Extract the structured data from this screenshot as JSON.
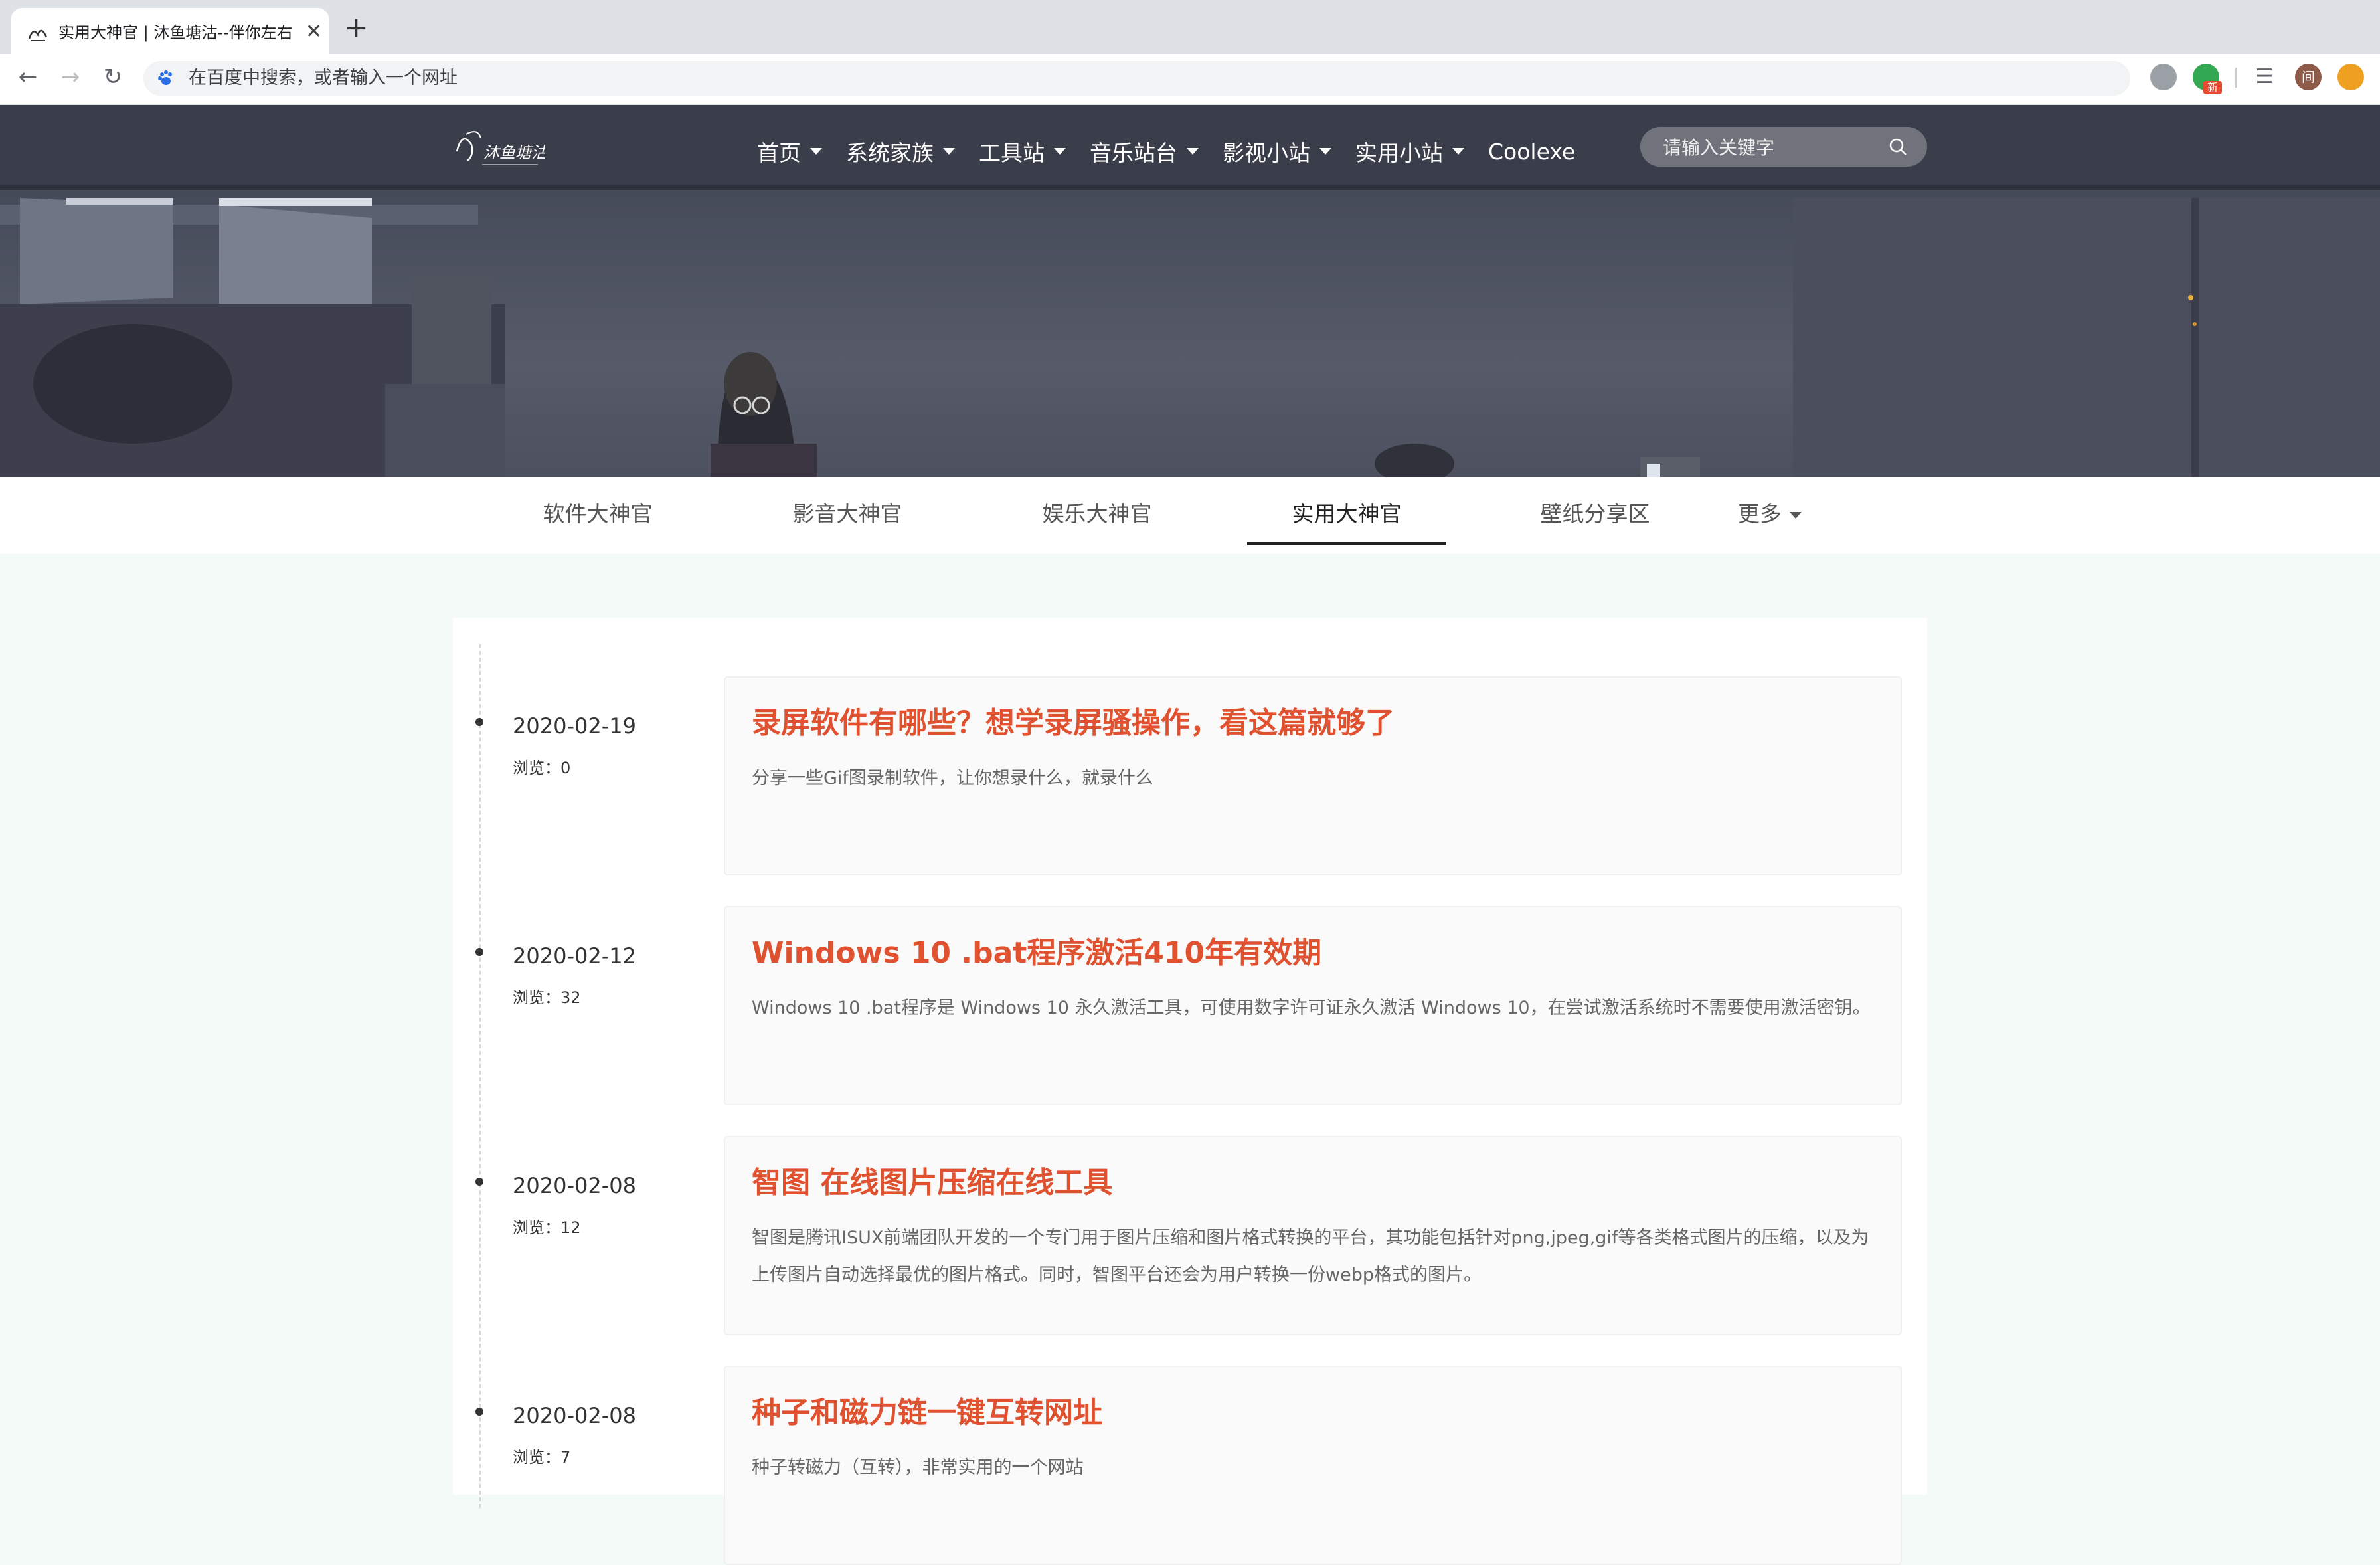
{
  "browser": {
    "tab_title": "实用大神官 | 沐鱼塘沽--伴你左右",
    "omnibox_placeholder": "在百度中搜索，或者输入一个网址",
    "ext_badge": "新",
    "profile_initial": "间"
  },
  "site": {
    "logo_text": "沐鱼塘沽",
    "nav": [
      {
        "label": "首页"
      },
      {
        "label": "系统家族"
      },
      {
        "label": "工具站"
      },
      {
        "label": "音乐站台"
      },
      {
        "label": "影视小站"
      },
      {
        "label": "实用小站"
      },
      {
        "label": "Coolexe"
      }
    ],
    "search_placeholder": "请输入关键字"
  },
  "categories": [
    {
      "label": "软件大神官"
    },
    {
      "label": "影音大神官"
    },
    {
      "label": "娱乐大神官"
    },
    {
      "label": "实用大神官",
      "active": true
    },
    {
      "label": "壁纸分享区"
    },
    {
      "label": "更多"
    }
  ],
  "posts": [
    {
      "date": "2020-02-19",
      "views": "浏览：0",
      "title": "录屏软件有哪些？想学录屏骚操作，看这篇就够了",
      "excerpt": "分享一些Gif图录制软件，让你想录什么，就录什么"
    },
    {
      "date": "2020-02-12",
      "views": "浏览：32",
      "title": "Windows 10 .bat程序激活410年有效期",
      "excerpt": "Windows 10 .bat程序是 Windows 10 永久激活工具，可使用数字许可证永久激活 Windows 10，在尝试激活系统时不需要使用激活密钥。"
    },
    {
      "date": "2020-02-08",
      "views": "浏览：12",
      "title": "智图 在线图片压缩在线工具",
      "excerpt": "智图是腾讯ISUX前端团队开发的一个专门用于图片压缩和图片格式转换的平台，其功能包括针对png,jpeg,gif等各类格式图片的压缩，以及为上传图片自动选择最优的图片格式。同时，智图平台还会为用户转换一份webp格式的图片。"
    },
    {
      "date": "2020-02-08",
      "views": "浏览：7",
      "title": "种子和磁力链一键互转网址",
      "excerpt": "种子转磁力（互转），非常实用的一个网站"
    }
  ],
  "colors": {
    "accent": "#e0512f",
    "page_bg": "#f3faf8"
  }
}
